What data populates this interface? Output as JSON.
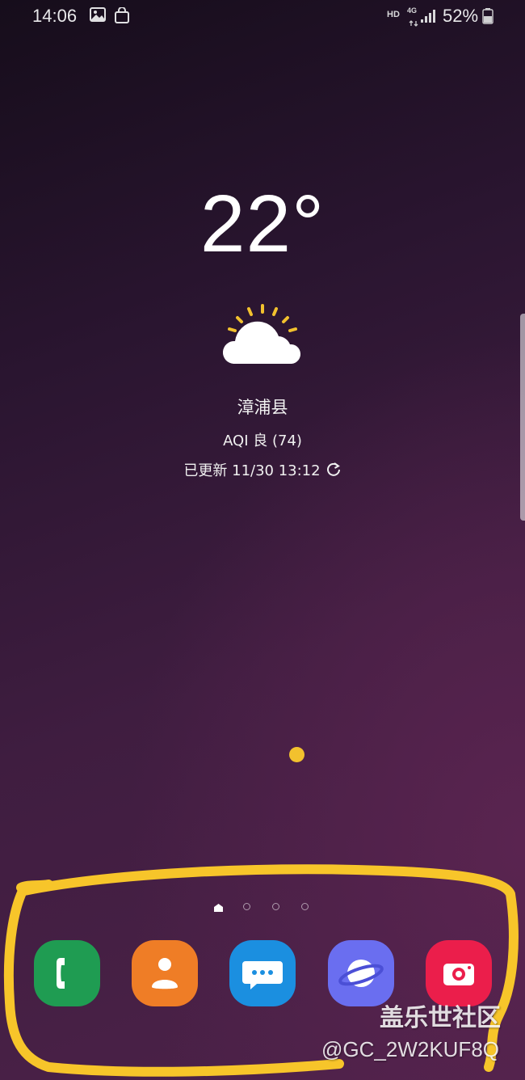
{
  "status_bar": {
    "time": "14:06",
    "left_icons": [
      "image-icon",
      "shopping-bag-icon"
    ],
    "network_hd": "HD",
    "network_type": "4G",
    "battery_percent": "52%",
    "battery_level": 0.52
  },
  "weather": {
    "temperature": "22°",
    "condition_icon": "partly-sunny-icon",
    "city": "漳浦县",
    "aqi": "AQI 良 (74)",
    "updated": "已更新 11/30 13:12",
    "sun_color": "#f2c12e"
  },
  "pager": {
    "total_pages": 3,
    "current": "home"
  },
  "dock": {
    "apps": [
      {
        "icon": "phone-icon",
        "color": "#1f9c52"
      },
      {
        "icon": "contacts-icon",
        "color": "#ef7d26"
      },
      {
        "icon": "messages-icon",
        "color": "#1b8fe0"
      },
      {
        "icon": "internet-icon",
        "color": "#6a6ef0"
      },
      {
        "icon": "camera-icon",
        "color": "#eb1e4b"
      }
    ]
  },
  "annotation": {
    "scribble_color": "#f7c52a"
  },
  "watermark": {
    "title": "盖乐世社区",
    "user": "@GC_2W2KUF8Q"
  }
}
